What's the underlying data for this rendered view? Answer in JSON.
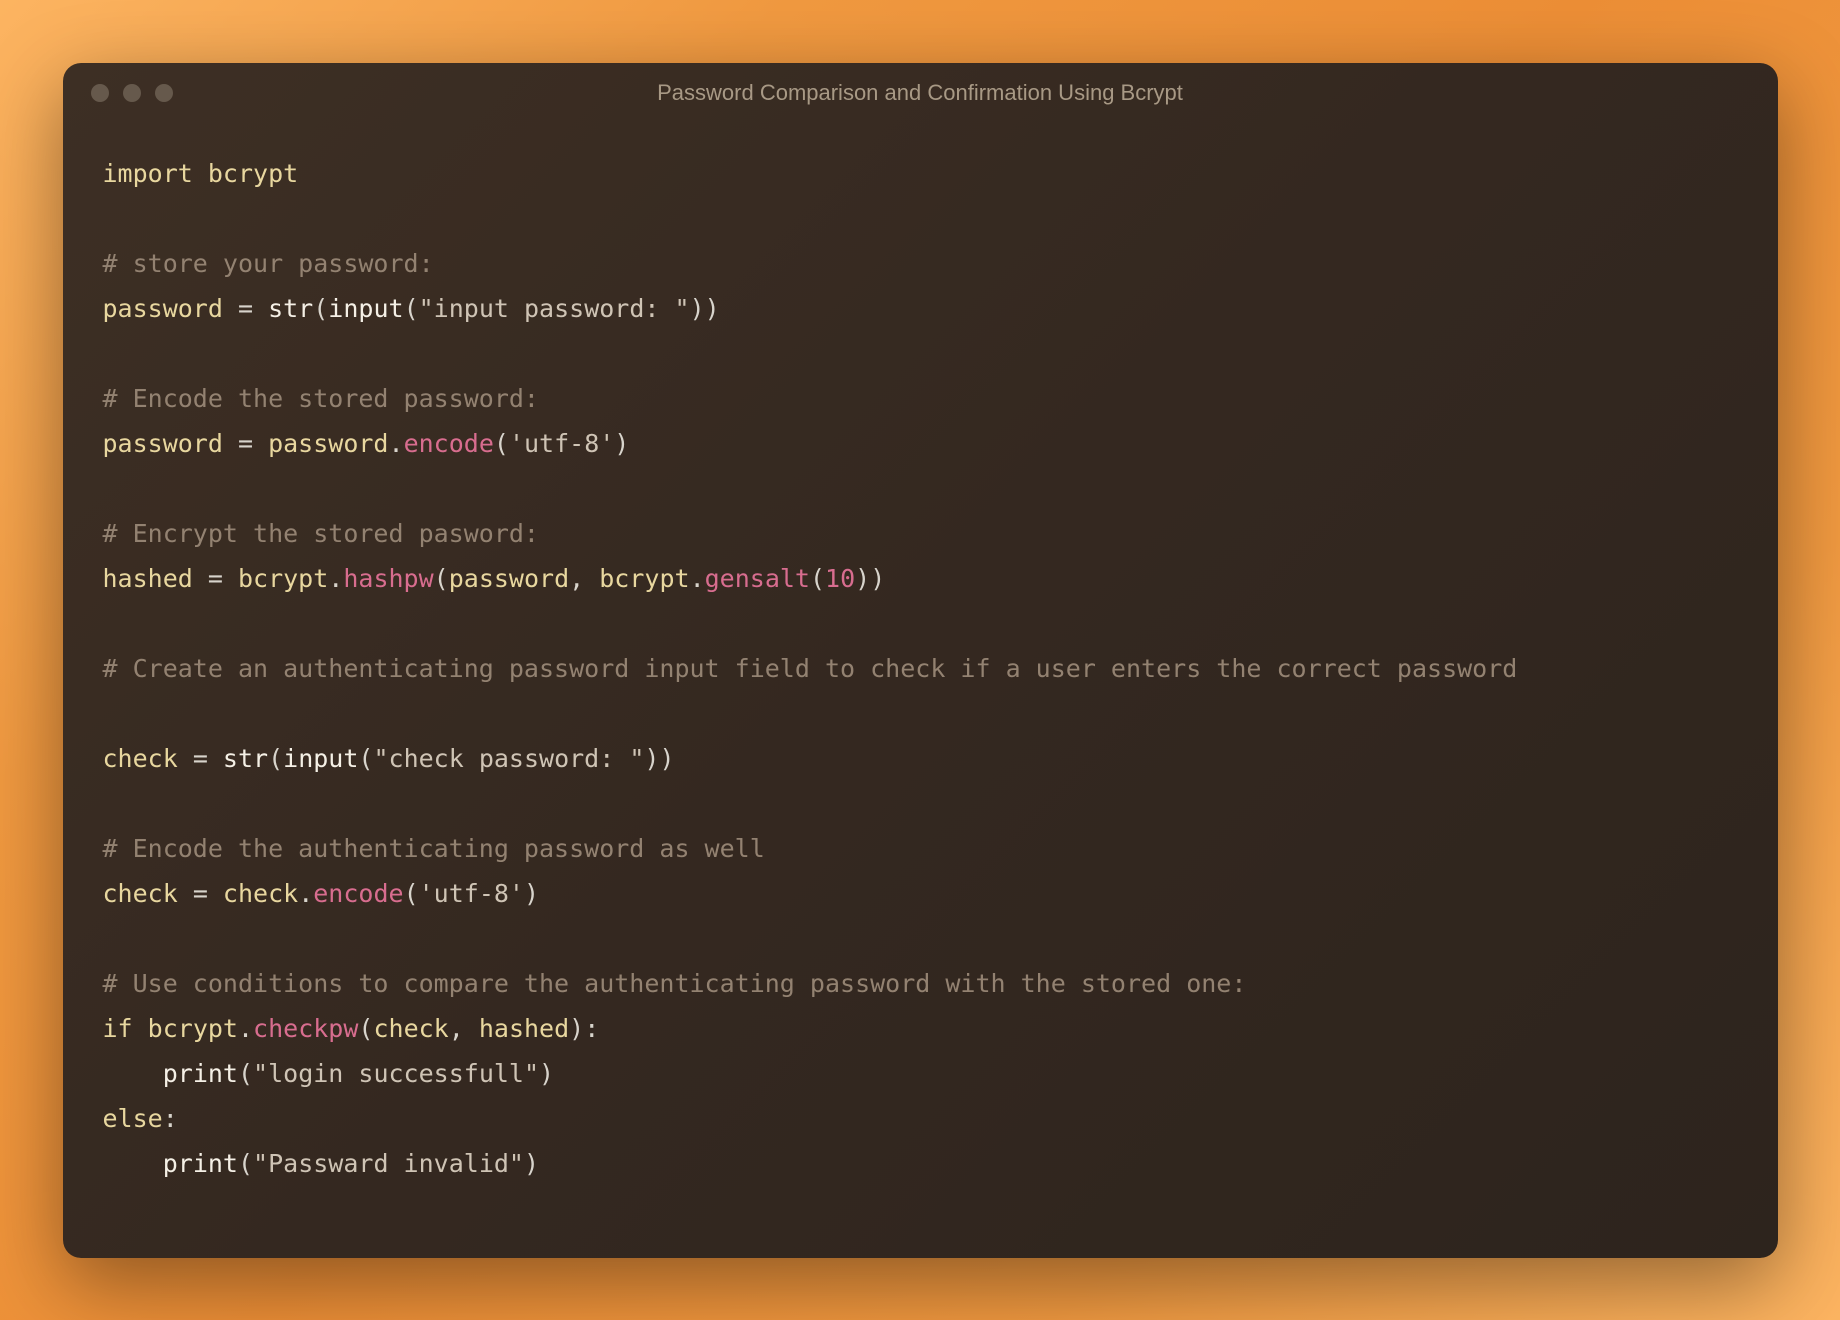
{
  "window": {
    "title": "Password Comparison and Confirmation Using Bcrypt"
  },
  "code": {
    "import_kw": "import",
    "import_mod": "bcrypt",
    "comment1": "# store your password:",
    "var_password": "password",
    "eq": " = ",
    "str_fn": "str",
    "input_fn": "input",
    "open_paren": "(",
    "close_paren": ")",
    "close_paren2": "))",
    "str_input_pw": "\"input password: \"",
    "comment2": "# Encode the stored password:",
    "dot": ".",
    "encode_method": "encode",
    "str_utf8": "'utf-8'",
    "comment3": "# Encrypt the stored pasword:",
    "var_hashed": "hashed",
    "hashpw_method": "hashpw",
    "comma_sp": ", ",
    "bcrypt_mod": "bcrypt",
    "gensalt_method": "gensalt",
    "num_10": "10",
    "comment4": "# Create an authenticating password input field to check if a user enters the correct password",
    "var_check": "check",
    "str_check_pw": "\"check password: \"",
    "comment5": "# Encode the authenticating password as well",
    "comment6": "# Use conditions to compare the authenticating password with the stored one:",
    "if_kw": "if",
    "checkpw_method": "checkpw",
    "colon": ":",
    "print_fn": "print",
    "str_login_ok": "\"login successfull\"",
    "else_kw": "else",
    "str_invalid": "\"Passward invalid\"",
    "indent": "    ",
    "space": " "
  }
}
